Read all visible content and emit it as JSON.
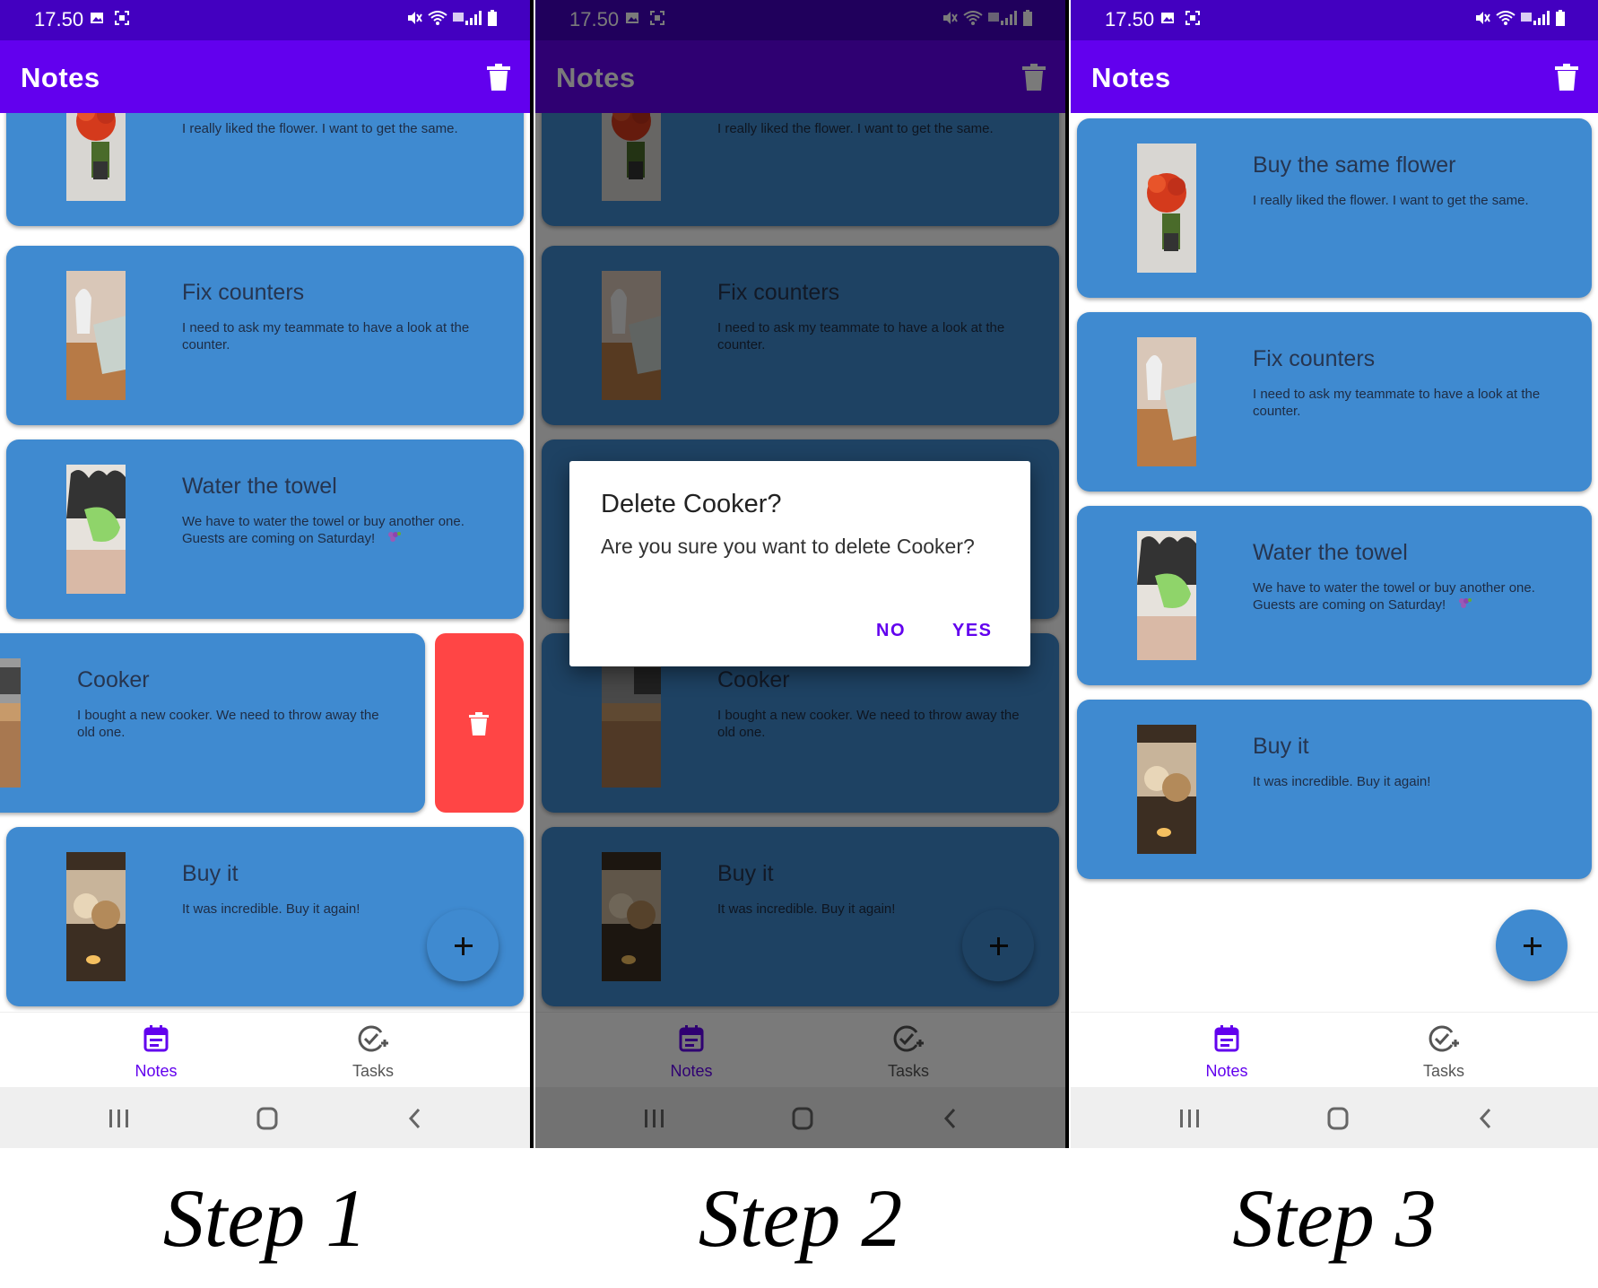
{
  "status": {
    "time": "17.50"
  },
  "app": {
    "title": "Notes"
  },
  "notes": [
    {
      "title": "Buy the same flower",
      "body": "I really liked the flower. I want to get the same."
    },
    {
      "title": "Fix counters",
      "body": "I need to ask my teammate to have a look at the counter."
    },
    {
      "title": "Water the towel",
      "body": "We have to water the towel or buy another one. Guests are coming on Saturday!"
    },
    {
      "title": "Cooker",
      "body": "I bought a new cooker. We need to throw away the old one."
    },
    {
      "title": "Buy it",
      "body": "It was incredible. Buy it again!"
    }
  ],
  "bottom_nav": {
    "notes": "Notes",
    "tasks": "Tasks"
  },
  "dialog": {
    "title": "Delete Cooker?",
    "message": "Are you sure you want to delete Cooker?",
    "no": "NO",
    "yes": "YES"
  },
  "captions": {
    "step1": "Step 1",
    "step2": "Step 2",
    "step3": "Step 3"
  },
  "colors": {
    "status_bar": "#4300c0",
    "app_bar": "#6200ee",
    "card": "#3f8ad0",
    "delete": "#ff4545",
    "accent": "#6200ee"
  },
  "icons": [
    "trash-icon",
    "plus-icon",
    "notes-nav-icon",
    "tasks-nav-icon",
    "recents-icon",
    "home-icon",
    "back-icon"
  ]
}
